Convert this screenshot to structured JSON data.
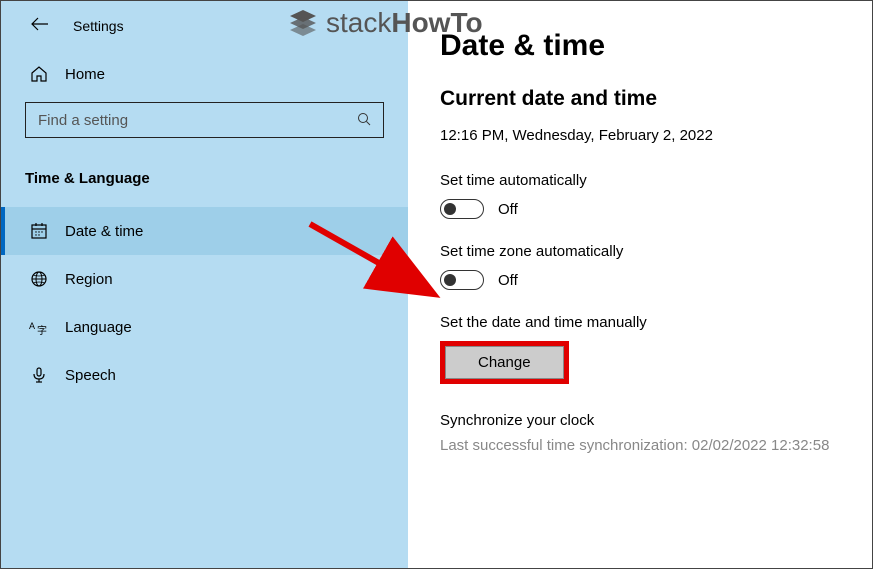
{
  "header": {
    "title": "Settings"
  },
  "sidebar": {
    "home_label": "Home",
    "search_placeholder": "Find a setting",
    "category": "Time & Language",
    "items": [
      {
        "label": "Date & time"
      },
      {
        "label": "Region"
      },
      {
        "label": "Language"
      },
      {
        "label": "Speech"
      }
    ]
  },
  "main": {
    "title": "Date & time",
    "current_section": "Current date and time",
    "current_value": "12:16 PM, Wednesday, February 2, 2022",
    "auto_time_label": "Set time automatically",
    "auto_time_state": "Off",
    "auto_zone_label": "Set time zone automatically",
    "auto_zone_state": "Off",
    "manual_label": "Set the date and time manually",
    "change_button": "Change",
    "sync_title": "Synchronize your clock",
    "sync_info": "Last successful time synchronization: 02/02/2022 12:32:58"
  },
  "watermark": {
    "text_light": "stack",
    "text_bold": "HowTo"
  }
}
